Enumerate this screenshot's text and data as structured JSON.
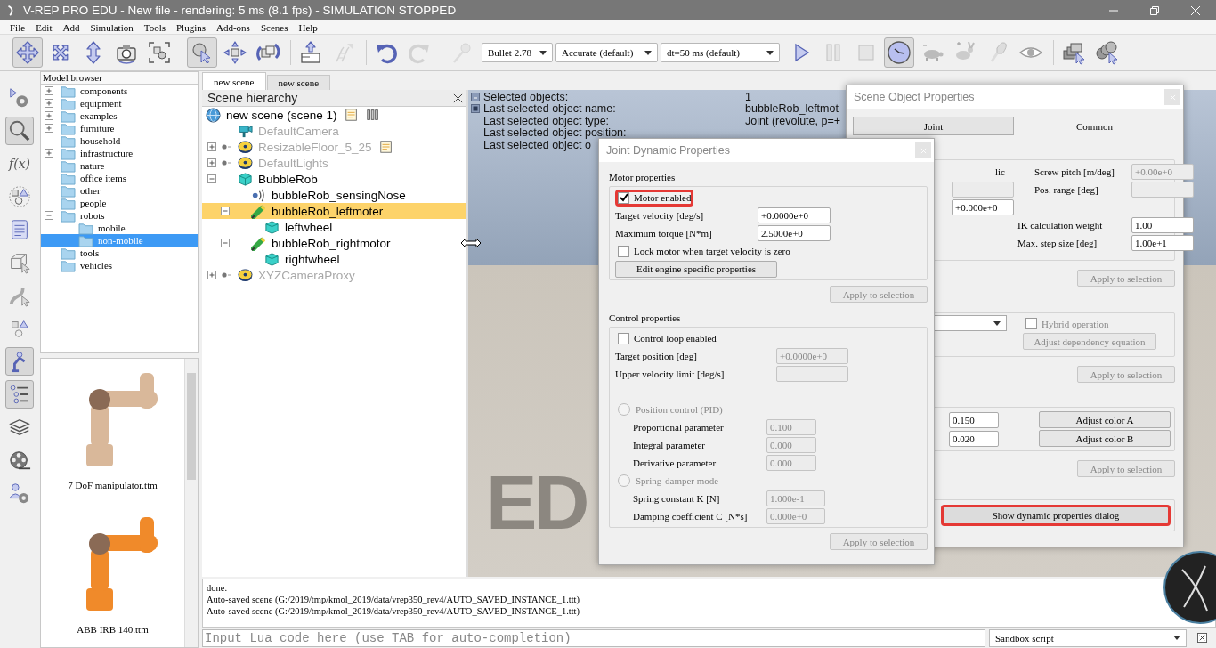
{
  "window": {
    "title": "V-REP PRO EDU - New file - rendering: 5 ms (8.1 fps) - SIMULATION STOPPED"
  },
  "menu": [
    "File",
    "Edit",
    "Add",
    "Simulation",
    "Tools",
    "Plugins",
    "Add-ons",
    "Scenes",
    "Help"
  ],
  "toolbar": {
    "tools": [
      {
        "selected": true,
        "disabled": false
      },
      {
        "selected": false,
        "disabled": false
      },
      {
        "selected": false,
        "disabled": false
      },
      {
        "selected": false,
        "disabled": false
      },
      {
        "selected": false,
        "disabled": false
      },
      {
        "selected": true,
        "disabled": false
      },
      {
        "selected": false,
        "disabled": false
      },
      {
        "selected": false,
        "disabled": false
      },
      {
        "selected": false,
        "disabled": false
      },
      {
        "selected": false,
        "disabled": true
      },
      {
        "selected": false,
        "disabled": false
      },
      {
        "selected": false,
        "disabled": true
      },
      {
        "selected": false,
        "disabled": true
      }
    ],
    "engine": "Bullet 2.78",
    "accuracy": "Accurate (default)",
    "timestep": "dt=50 ms (default)",
    "sim_tools": [
      {
        "selected": false,
        "disabled": false
      },
      {
        "selected": false,
        "disabled": true
      },
      {
        "selected": false,
        "disabled": true
      },
      {
        "selected": true,
        "disabled": false
      },
      {
        "selected": false,
        "disabled": false
      },
      {
        "selected": false,
        "disabled": false
      },
      {
        "selected": false,
        "disabled": false
      },
      {
        "selected": false,
        "disabled": false
      },
      {
        "selected": false,
        "disabled": false
      },
      {
        "selected": false,
        "disabled": false
      }
    ]
  },
  "left_tools": [
    {
      "selected": false
    },
    {
      "selected": true
    },
    {
      "selected": false,
      "label": "f(x)"
    },
    {
      "selected": false
    },
    {
      "selected": false
    },
    {
      "selected": false
    },
    {
      "selected": false
    },
    {
      "selected": false
    },
    {
      "selected": true
    },
    {
      "selected": true
    },
    {
      "selected": false
    },
    {
      "selected": false
    },
    {
      "selected": false
    }
  ],
  "model_browser": {
    "title": "Model browser",
    "items": [
      {
        "label": "components",
        "expandable": true,
        "expanded": false,
        "selected": false
      },
      {
        "label": "equipment",
        "expandable": true,
        "expanded": false,
        "selected": false
      },
      {
        "label": "examples",
        "expandable": true,
        "expanded": false,
        "selected": false
      },
      {
        "label": "furniture",
        "expandable": true,
        "expanded": false,
        "selected": false
      },
      {
        "label": "household",
        "expandable": false,
        "selected": false
      },
      {
        "label": "infrastructure",
        "expandable": true,
        "expanded": false,
        "selected": false
      },
      {
        "label": "nature",
        "expandable": false,
        "selected": false
      },
      {
        "label": "office items",
        "expandable": false,
        "selected": false
      },
      {
        "label": "other",
        "expandable": false,
        "selected": false
      },
      {
        "label": "people",
        "expandable": false,
        "selected": false
      },
      {
        "label": "robots",
        "expandable": true,
        "expanded": true,
        "selected": false,
        "children": [
          {
            "label": "mobile",
            "expandable": false,
            "selected": false
          },
          {
            "label": "non-mobile",
            "expandable": false,
            "selected": true
          }
        ]
      },
      {
        "label": "tools",
        "expandable": false,
        "selected": false
      },
      {
        "label": "vehicles",
        "expandable": false,
        "selected": false
      }
    ],
    "thumbnails": [
      {
        "label": "7 DoF manipulator.ttm",
        "color": "#d9b89a"
      },
      {
        "label": "ABB IRB 140.ttm",
        "color": "#f08a2a"
      }
    ]
  },
  "scene_tabs": [
    {
      "label": "new scene",
      "selected": true
    },
    {
      "label": "new scene",
      "selected": false
    }
  ],
  "hierarchy": {
    "title": "Scene hierarchy",
    "nodes": [
      {
        "label": "new scene (scene 1)",
        "kind": "scene",
        "selected": false,
        "dimmed": false,
        "script": true,
        "bars": true,
        "children": [
          {
            "label": "DefaultCamera",
            "kind": "camera",
            "expandable": false,
            "selected": false,
            "dimmed": true
          },
          {
            "label": "ResizableFloor_5_25",
            "kind": "model",
            "expandable": true,
            "expanded": false,
            "selected": false,
            "dimmed": true,
            "script": true
          },
          {
            "label": "DefaultLights",
            "kind": "model",
            "expandable": true,
            "expanded": false,
            "selected": false,
            "dimmed": true
          },
          {
            "label": "BubbleRob",
            "kind": "shape",
            "expandable": true,
            "expanded": true,
            "selected": false,
            "dimmed": false,
            "children": [
              {
                "label": "bubbleRob_sensingNose",
                "kind": "sensor",
                "expandable": false,
                "selected": false,
                "dimmed": false
              },
              {
                "label": "bubbleRob_leftmoter",
                "kind": "joint",
                "expandable": true,
                "expanded": true,
                "selected": true,
                "dimmed": false,
                "children": [
                  {
                    "label": "leftwheel",
                    "kind": "shape",
                    "expandable": false,
                    "selected": false,
                    "dimmed": false
                  }
                ]
              },
              {
                "label": "bubbleRob_rightmotor",
                "kind": "joint",
                "expandable": true,
                "expanded": true,
                "selected": false,
                "dimmed": false,
                "children": [
                  {
                    "label": "rightwheel",
                    "kind": "shape",
                    "expandable": false,
                    "selected": false,
                    "dimmed": false
                  }
                ]
              }
            ]
          },
          {
            "label": "XYZCameraProxy",
            "kind": "model",
            "expandable": true,
            "expanded": false,
            "selected": false,
            "dimmed": true
          }
        ]
      }
    ]
  },
  "viewport": {
    "info": [
      {
        "label": "Selected objects:",
        "value": "1",
        "expanded": true
      },
      {
        "label": "Last selected object name:",
        "value": "bubbleRob_leftmot",
        "expanded": false
      },
      {
        "label": "Last selected object type:",
        "value": "Joint (revolute, p=+"
      },
      {
        "label": "Last selected object position:"
      },
      {
        "label": "Last selected object o"
      }
    ],
    "watermark": "ED"
  },
  "scene_object_properties": {
    "title": "Scene Object Properties",
    "tabs": [
      {
        "label": "Joint",
        "selected": true
      },
      {
        "label": "Common",
        "selected": false
      }
    ],
    "fragment": "lic",
    "mode_field": {
      "disabled": true
    },
    "position_field": {
      "value": "+0.000e+0",
      "disabled": false
    },
    "fields": [
      {
        "label": "Screw pitch [m/deg]",
        "value": "+0.00e+0",
        "disabled": true
      },
      {
        "label": "Pos. range [deg]",
        "disabled": true
      },
      {
        "label": "IK calculation weight",
        "value": "1.00",
        "disabled": false
      },
      {
        "label": "Max. step size [deg]",
        "value": "1.00e+1",
        "disabled": false
      }
    ],
    "hybrid": {
      "label": "Hybrid operation",
      "checked": false,
      "disabled": true
    },
    "dependency_button": {
      "label": "Adjust dependency equation",
      "disabled": true
    },
    "colors": [
      {
        "value": "0.150",
        "button": "Adjust color A"
      },
      {
        "value": "0.020",
        "button": "Adjust color B"
      }
    ],
    "applies": [
      {
        "label": "Apply to selection",
        "disabled": true
      },
      {
        "label": "Apply to selection",
        "disabled": true
      },
      {
        "label": "Apply to selection",
        "disabled": true
      }
    ],
    "dynamics_button": {
      "label": "Show dynamic properties dialog",
      "highlighted": true
    }
  },
  "joint_dynamic_properties": {
    "title": "Joint Dynamic Properties",
    "motor": {
      "heading": "Motor properties",
      "enabled": {
        "label": "Motor enabled",
        "checked": true,
        "highlighted": true
      },
      "fields": [
        {
          "label": "Target velocity [deg/s]",
          "value": "+0.0000e+0",
          "disabled": false
        },
        {
          "label": "Maximum torque [N*m]",
          "value": "2.5000e+0",
          "disabled": false
        }
      ],
      "lock": {
        "label": "Lock motor when target velocity is zero",
        "checked": false
      },
      "engine_button": "Edit engine specific properties",
      "apply": {
        "label": "Apply to selection",
        "disabled": true
      }
    },
    "control": {
      "heading": "Control properties",
      "loop": {
        "label": "Control loop enabled",
        "checked": false
      },
      "fields": [
        {
          "label": "Target position [deg]",
          "value": "+0.0000e+0",
          "disabled": true
        },
        {
          "label": "Upper velocity limit [deg/s]",
          "disabled": true
        }
      ],
      "modes": [
        {
          "label": "Position control (PID)",
          "selected": false,
          "disabled": true,
          "params": [
            {
              "label": "Proportional parameter",
              "value": "0.100",
              "disabled": true
            },
            {
              "label": "Integral parameter",
              "value": "0.000",
              "disabled": true
            },
            {
              "label": "Derivative parameter",
              "value": "0.000",
              "disabled": true
            }
          ]
        },
        {
          "label": "Spring-damper mode",
          "selected": false,
          "disabled": true,
          "params": [
            {
              "label": "Spring constant K [N]",
              "value": "1.000e-1",
              "disabled": true
            },
            {
              "label": "Damping coefficient C [N*s]",
              "value": "0.000e+0",
              "disabled": true
            }
          ]
        }
      ],
      "apply": {
        "label": "Apply to selection",
        "disabled": true
      }
    }
  },
  "console": {
    "lines": [
      "done.",
      "Auto-saved scene (G:/2019/tmp/kmol_2019/data/vrep350_rev4/AUTO_SAVED_INSTANCE_1.ttt)",
      "Auto-saved scene (G:/2019/tmp/kmol_2019/data/vrep350_rev4/AUTO_SAVED_INSTANCE_1.ttt)"
    ],
    "placeholder": "Input Lua code here (use TAB for auto-completion)",
    "script_type": "Sandbox script"
  }
}
